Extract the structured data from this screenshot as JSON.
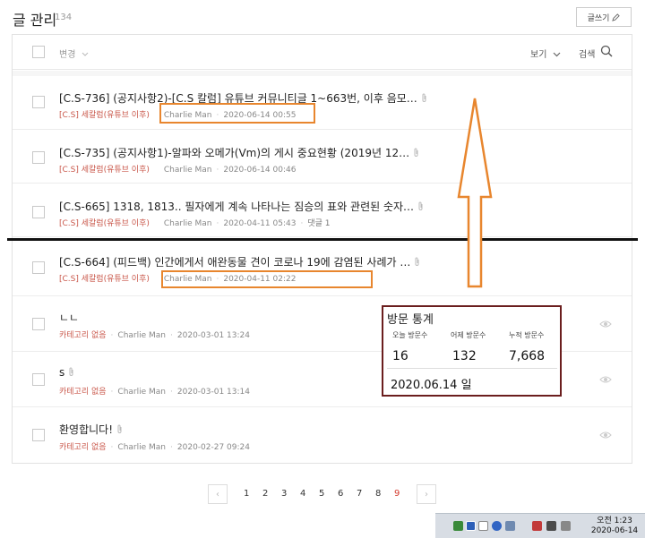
{
  "header": {
    "title": "글 관리",
    "count": "134",
    "write_label": "글쓰기"
  },
  "toolbar": {
    "change_label": "변경",
    "view_label": "보기",
    "search_label": "검색"
  },
  "posts": [
    {
      "title": "[C.S-736] (공지사항2)-[C.S 칼럼] 유튜브 커뮤니티글 1~663번, 이후 음모…",
      "category": "[C.S] 세칼럼(유튜브 이후)",
      "author": "Charlie Man",
      "date": "2020-06-14 00:55",
      "comments": ""
    },
    {
      "title": "[C.S-735] (공지사항1)-알파와 오메가(Vm)의 게시 중요현황 (2019년 12…",
      "category": "[C.S] 세칼럼(유튜브 이후)",
      "author": "Charlie Man",
      "date": "2020-06-14 00:46",
      "comments": ""
    },
    {
      "title": "[C.S-665] 1318, 1813.. 필자에게 계속 나타나는 짐승의 표와 관련된 숫자…",
      "category": "[C.S] 세칼럼(유튜브 이후)",
      "author": "Charlie Man",
      "date": "2020-04-11 05:43",
      "comments": "댓글 1"
    },
    {
      "title": "[C.S-664] (피드백) 인간에게서 애완동물 견이 코로나 19에 감염된 사례가 …",
      "category": "[C.S] 세칼럼(유튜브 이후)",
      "author": "Charlie Man",
      "date": "2020-04-11 02:22",
      "comments": ""
    },
    {
      "title": "ㄴㄴ",
      "category": "카테고리 없음",
      "author": "Charlie Man",
      "date": "2020-03-01 13:24",
      "comments": ""
    },
    {
      "title": "s",
      "category": "카테고리 없음",
      "author": "Charlie Man",
      "date": "2020-03-01 13:14",
      "comments": ""
    },
    {
      "title": "환영합니다!",
      "category": "카테고리 없음",
      "author": "Charlie Man",
      "date": "2020-02-27 09:24",
      "comments": ""
    }
  ],
  "stats": {
    "title": "방문 통계",
    "today_label": "오늘 방문수",
    "yesterday_label": "어제 방문수",
    "total_label": "누적 방문수",
    "today": "16",
    "yesterday": "132",
    "total": "7,668",
    "date": "2020.06.14 일"
  },
  "pagination": {
    "prev": "‹",
    "next": "›",
    "pages": [
      "1",
      "2",
      "3",
      "4",
      "5",
      "6",
      "7",
      "8",
      "9"
    ],
    "active": "9"
  },
  "taskbar": {
    "time": "오전 1:23",
    "date": "2020-06-14"
  },
  "colors": {
    "accent_orange": "#e8862e",
    "category_red": "#c9574a",
    "stats_border": "#6b1e1e",
    "active_page": "#d43b2e"
  }
}
